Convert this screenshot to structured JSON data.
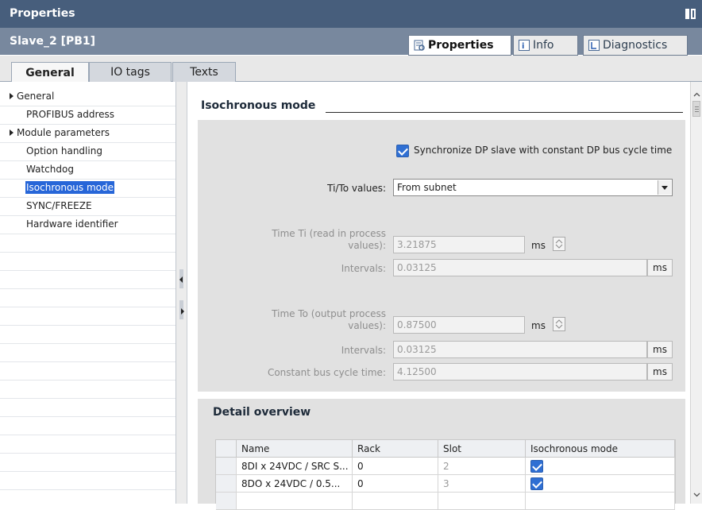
{
  "window": {
    "title": "Properties"
  },
  "object": {
    "name": "Slave_2 [PB1]"
  },
  "top_tabs": [
    {
      "label": "Properties",
      "icon": "properties-icon"
    },
    {
      "label": "Info",
      "icon": "info-icon"
    },
    {
      "label": "Diagnostics",
      "icon": "diagnostics-icon"
    }
  ],
  "sub_tabs": [
    {
      "label": "General"
    },
    {
      "label": "IO tags"
    },
    {
      "label": "Texts"
    }
  ],
  "nav": {
    "items": [
      {
        "label": "General",
        "expandable": true
      },
      {
        "label": "PROFIBUS address",
        "expandable": false
      },
      {
        "label": "Module parameters",
        "expandable": true
      },
      {
        "label": "Option handling",
        "expandable": false
      },
      {
        "label": "Watchdog",
        "expandable": false
      },
      {
        "label": "Isochronous mode",
        "expandable": false,
        "selected": true
      },
      {
        "label": "SYNC/FREEZE",
        "expandable": false
      },
      {
        "label": "Hardware identifier",
        "expandable": false
      }
    ]
  },
  "section": {
    "title": "Isochronous mode",
    "sync_checkbox": {
      "label": "Synchronize DP slave with constant DP bus cycle time",
      "checked": true
    },
    "tito": {
      "label": "Ti/To values:",
      "value": "From subnet"
    },
    "time_ti": {
      "label_line1": "Time Ti (read in process",
      "label_line2": "values):",
      "value": "3.21875",
      "unit": "ms"
    },
    "ti_intervals": {
      "label": "Intervals:",
      "value": "0.03125",
      "unit": "ms"
    },
    "time_to": {
      "label_line1": "Time To (output process",
      "label_line2": "values):",
      "value": "0.87500",
      "unit": "ms"
    },
    "to_intervals": {
      "label": "Intervals:",
      "value": "0.03125",
      "unit": "ms"
    },
    "bus_cycle": {
      "label": "Constant bus cycle time:",
      "value": "4.12500",
      "unit": "ms"
    }
  },
  "detail": {
    "title": "Detail overview",
    "columns": [
      "Name",
      "Rack",
      "Slot",
      "Isochronous mode"
    ],
    "rows": [
      {
        "name": "8DI x 24VDC / SRC S...",
        "rack": "0",
        "slot": "2",
        "isochronous": true
      },
      {
        "name": "8DO x 24VDC / 0.5...",
        "rack": "0",
        "slot": "3",
        "isochronous": true
      }
    ]
  },
  "colors": {
    "title_bar": "#475e7c",
    "object_bar": "#78889e",
    "selection": "#2766d8",
    "panel": "#e1e1e1"
  }
}
